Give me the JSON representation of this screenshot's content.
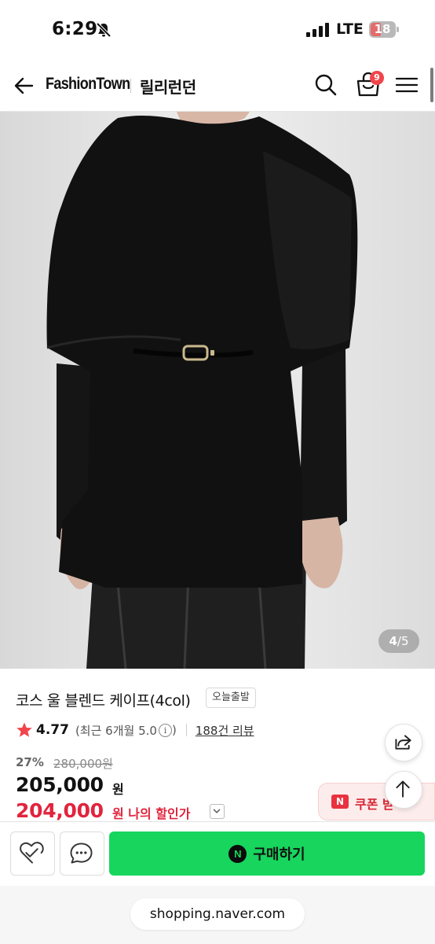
{
  "status_bar": {
    "time": "6:29",
    "network": "LTE",
    "battery": "18",
    "battery_level": 0.18
  },
  "header": {
    "brand": "FashionTown",
    "store": "릴리런던",
    "cart_count": "9"
  },
  "product": {
    "image_counter_current": "4",
    "image_counter_total": "/5",
    "title": "코스 울 블렌드 케이프(4col)",
    "delivery_badge": "오늘출발",
    "rating": "4.77",
    "rating_detail": "(최근 6개월 5.0",
    "rating_info": "i",
    "rating_close": ")",
    "review_count": "188건 리뷰",
    "discount_rate": "27%",
    "original_price": "280,000원",
    "sale_price": "205,000",
    "sale_unit": "원",
    "my_price": "204,000",
    "my_price_label": "원 나의 할인가"
  },
  "floating": {
    "coupon_icon": "N",
    "coupon_label": "쿠폰 받"
  },
  "action_bar": {
    "npay_icon": "N",
    "buy_label": "구매하기"
  },
  "browser": {
    "url": "shopping.naver.com"
  },
  "icons": {
    "back": "arrow-left-icon",
    "search": "search-icon",
    "cart": "shopping-bag-icon",
    "menu": "hamburger-icon",
    "share": "share-icon",
    "top": "arrow-up-icon",
    "wish": "heart-check-icon",
    "talk": "chat-icon"
  },
  "colors": {
    "buy_green": "#17d55d",
    "price_red": "#e1243d",
    "badge_red": "#f0454b"
  }
}
